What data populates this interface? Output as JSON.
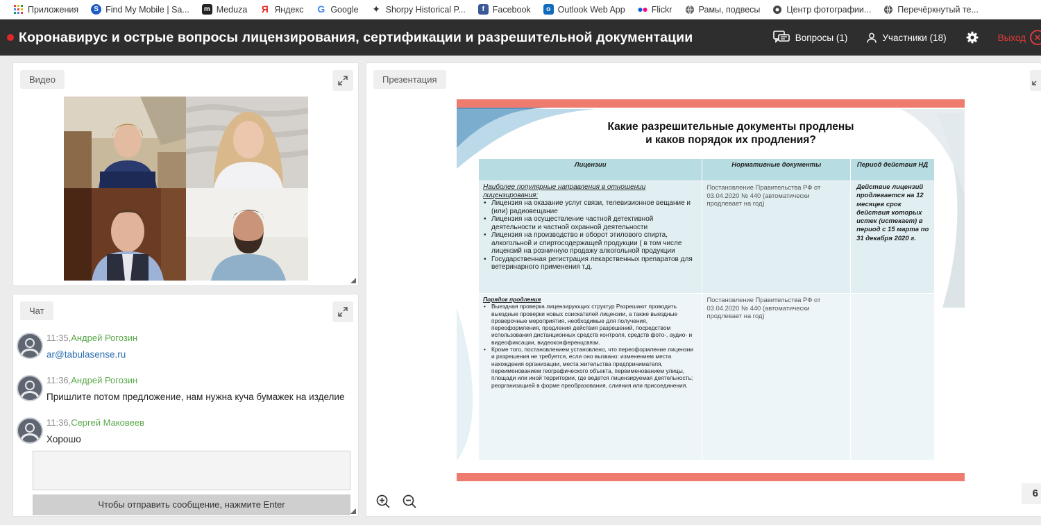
{
  "bookmarks": [
    {
      "label": "Приложения",
      "icon": "apps-grid-icon",
      "color": "#e34133"
    },
    {
      "label": "Find My Mobile | Sa...",
      "icon": "samsung-icon",
      "color": "#1e5ac8"
    },
    {
      "label": "Meduza",
      "icon": "meduza-icon",
      "color": "#222222"
    },
    {
      "label": "Яндекс",
      "icon": "yandex-icon",
      "color": "#e6261f"
    },
    {
      "label": "Google",
      "icon": "google-icon",
      "color": "#4285f4"
    },
    {
      "label": "Shorpy Historical P...",
      "icon": "shorpy-icon",
      "color": "#333333"
    },
    {
      "label": "Facebook",
      "icon": "facebook-icon",
      "color": "#3b5998"
    },
    {
      "label": "Outlook Web App",
      "icon": "outlook-icon",
      "color": "#0f6cbd"
    },
    {
      "label": "Flickr",
      "icon": "flickr-icon",
      "color": "#ff0084"
    },
    {
      "label": "Рамы, подвесы",
      "icon": "globe-icon",
      "color": "#666666"
    },
    {
      "label": "Центр фотографии...",
      "icon": "globe-icon",
      "color": "#444444"
    },
    {
      "label": "Перечёркнутый те...",
      "icon": "globe-icon",
      "color": "#555555"
    }
  ],
  "header": {
    "title": "Коронавирус и острые вопросы лицензирования, сертификации и разрешительной документации",
    "questions_label": "Вопросы (1)",
    "participants_label": "Участники (18)",
    "exit_label": "Выход",
    "exit_icon": "✕"
  },
  "video": {
    "tab_label": "Видео"
  },
  "chat": {
    "tab_label": "Чат",
    "messages": [
      {
        "time": "11:35,",
        "author": "Андрей Рогозин",
        "text": "ar@tabulasense.ru"
      },
      {
        "time": "11:36,",
        "author": "Андрей Рогозин",
        "text": "Пришлите потом предложение, нам нужна куча бумажек на изделие"
      },
      {
        "time": "11:36,",
        "author": "Сергей Маковеев",
        "text": "Хорошо"
      }
    ],
    "send_hint": "Чтобы отправить сообщение, нажмите Enter"
  },
  "presentation": {
    "tab_label": "Презентация",
    "page_number": "6",
    "slide": {
      "title_line1": "Какие разрешительные документы продлены",
      "title_line2": "и каков порядок их продления?",
      "col_licenses": "Лицензии",
      "col_docs": "Нормативные документы",
      "col_period": "Период действия НД",
      "row1": {
        "heading": "Наиболее популярные направления в отношении лицензирования:",
        "items": [
          "Лицензия на оказание услуг связи, телевизионное вещание и (или) радиовещание",
          "Лицензия на осуществление частной  детективной деятельности и частной охранной деятельности",
          "Лицензия на производство и оборот этилового спирта, алкогольной и спиртосодержащей продукции ( в том числе лицензий на розничную продажу алкогольной  продукции",
          "Государственная регистрация лекарственных препаратов для ветеринарного применения т.д."
        ],
        "doc": "Постановление Правительства РФ от 03.04.2020 № 440  (автоматически продлевает  на год)",
        "period": "Действие лицензий продлевается на 12 месяцев срок действия которых истек (истекает) в период с 15 марта по 31 декабря 2020 г."
      },
      "row2": {
        "heading": "Порядок продления",
        "items": [
          "Выездная проверка лицензирующих структур Разрешают проводить выездные проверки новых соискателей лицензии, а также выездные проверочные мероприятия, необходимые для получения, переоформления, продления действия разрешений, посредством использования дистанционных средств контроля, средств фото-, аудио- и видеофиксации, видеоконференцсвязи.",
          "Кроме того, постановлением установлено, что переоформление лицензии и разрешения не требуется, если оно вызвано: изменением места нахождения организации, места жительства предпринимателя, переименованием географического объекта, переименованием улицы, площади или иной территории, где ведется лицензируемая деятельность; реорганизацией в форме преобразования, слияния или присоединения."
        ],
        "doc": "Постановление Правительства РФ от 03.04.2020 № 440  (автоматически продлевает  на год)"
      }
    }
  },
  "colors": {
    "header_bg": "#2e2e2e",
    "record": "#e02828",
    "exit": "#e23a3a",
    "author": "#5aa84a",
    "link": "#2a6db3",
    "slide_bar": "#ef7b6e",
    "table_header": "#b7dde3"
  }
}
